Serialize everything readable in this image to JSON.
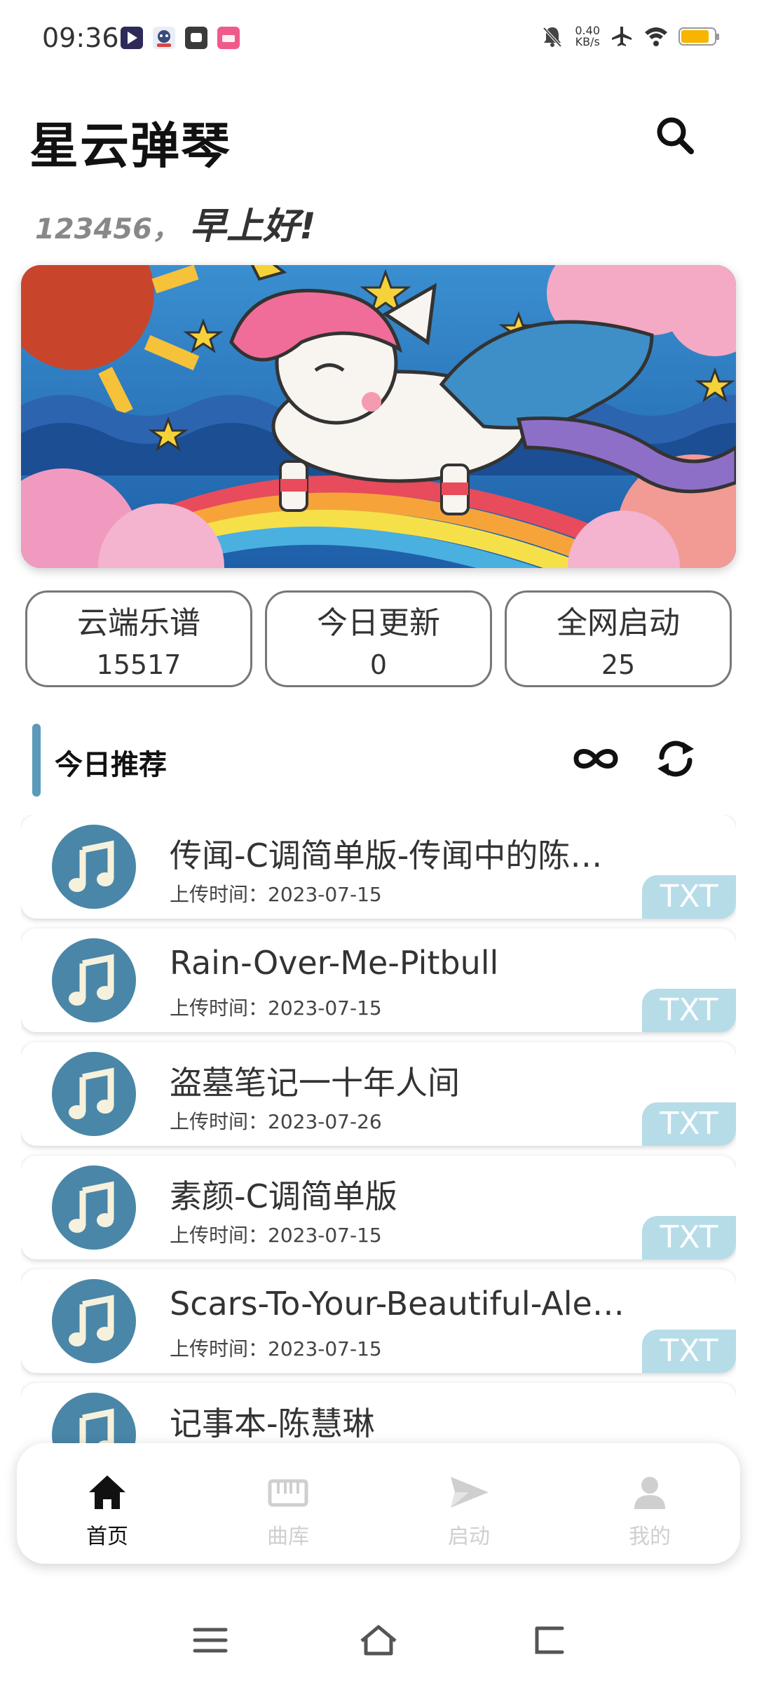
{
  "status_bar": {
    "time": "09:36",
    "net_speed_value": "0.40",
    "net_speed_unit": "KB/s",
    "battery_level": 0.85,
    "app_icons": [
      "video-app-icon",
      "game-app-icon",
      "message-app-icon",
      "shop-app-icon"
    ]
  },
  "header": {
    "title": "星云弹琴",
    "search_icon": "search-icon"
  },
  "greeting": {
    "user": "123456，",
    "text": "早上好!"
  },
  "stats": [
    {
      "label": "云端乐谱",
      "value": "15517"
    },
    {
      "label": "今日更新",
      "value": "0"
    },
    {
      "label": "全网启动",
      "value": "25"
    }
  ],
  "section": {
    "title": "今日推荐",
    "loop_icon": "infinity-loop-icon",
    "refresh_icon": "refresh-icon"
  },
  "songs": [
    {
      "title": "传闻-C调简单版-传闻中的陈芊芊",
      "upload": "上传时间：2023-07-15",
      "badge": "TXT"
    },
    {
      "title": "Rain-Over-Me-Pitbull",
      "upload": "上传时间：2023-07-15",
      "badge": "TXT"
    },
    {
      "title": "盗墓笔记一十年人间",
      "upload": "上传时间：2023-07-26",
      "badge": "TXT"
    },
    {
      "title": "素颜-C调简单版",
      "upload": "上传时间：2023-07-15",
      "badge": "TXT"
    },
    {
      "title": "Scars-To-Your-Beautiful-Alessia",
      "upload": "上传时间：2023-07-15",
      "badge": "TXT"
    },
    {
      "title": "记事本-陈慧琳",
      "upload": "",
      "badge": ""
    }
  ],
  "bottom_nav": [
    {
      "label": "首页",
      "icon": "home-icon",
      "active": true
    },
    {
      "label": "曲库",
      "icon": "piano-keys-icon",
      "active": false
    },
    {
      "label": "启动",
      "icon": "send-icon",
      "active": false
    },
    {
      "label": "我的",
      "icon": "person-icon",
      "active": false
    }
  ],
  "colors": {
    "accent": "#4a86a8",
    "section_bar": "#5b9ab8",
    "badge_bg": "#b6dce8",
    "battery": "#f7b500"
  }
}
